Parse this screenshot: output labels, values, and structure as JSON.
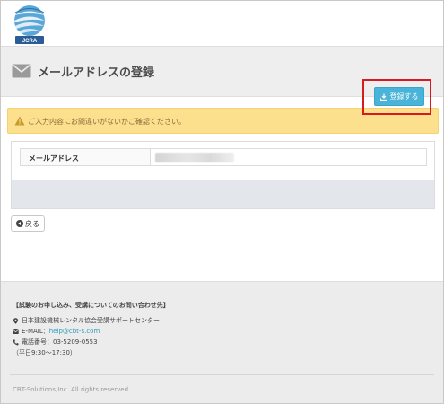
{
  "header": {
    "logo_text": "JCRA"
  },
  "title_band": {
    "title": "メールアドレスの登録",
    "icon": "envelope-icon"
  },
  "alert": {
    "icon": "warning-icon",
    "text": "ご入力内容にお間違いがないかご確認ください。",
    "color": "#fde08d"
  },
  "form": {
    "fields": [
      {
        "label": "メールアドレス",
        "value": ""
      }
    ],
    "register_label": "登録する",
    "register_color": "#4ab3d8",
    "highlight_color": "#d8191f"
  },
  "back_button": {
    "label": "戻る"
  },
  "footer": {
    "contact_title": "【試験のお申し込み、受講についてのお問い合わせ先】",
    "organization": "日本建設機械レンタル協会受講サポートセンター",
    "email_label": "E-MAIL：",
    "email": "help@cbt-s.com",
    "phone_label": "電話番号：",
    "phone": "03-5209-0553",
    "hours": "（平日9:30～17:30）",
    "copyright": "CBT-Solutions,Inc. All rights reserved."
  }
}
